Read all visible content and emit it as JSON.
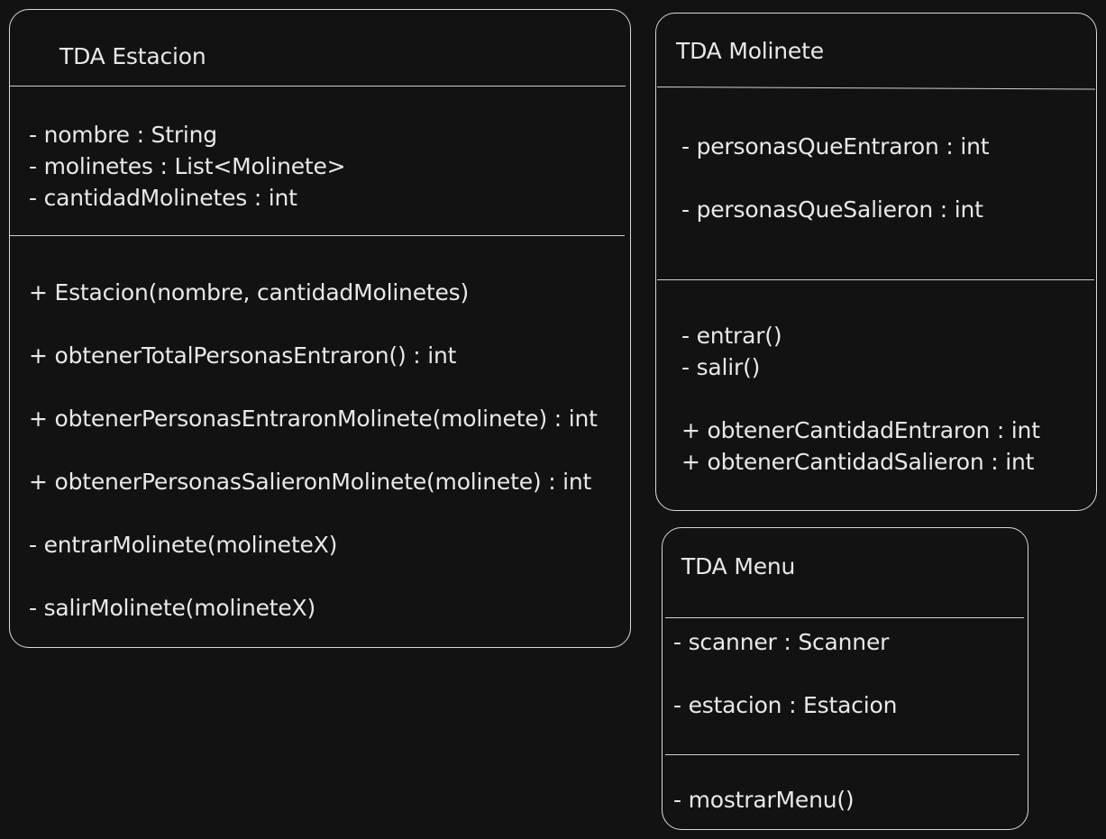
{
  "estacion": {
    "title": "TDA Estacion",
    "attributes": [
      "- nombre : String",
      "- molinetes : List<Molinete>",
      "- cantidadMolinetes : int"
    ],
    "methods": [
      "+ Estacion(nombre, cantidadMolinetes)",
      "+ obtenerTotalPersonasEntraron() : int",
      "+ obtenerPersonasEntraronMolinete(molinete) : int",
      "+ obtenerPersonasSalieronMolinete(molinete) : int",
      "- entrarMolinete(molineteX)",
      "- salirMolinete(molineteX)"
    ]
  },
  "molinete": {
    "title": "TDA Molinete",
    "attributes": [
      "- personasQueEntraron : int",
      "- personasQueSalieron : int"
    ],
    "methods": [
      "- entrar()",
      "- salir()",
      "+ obtenerCantidadEntraron : int",
      "+ obtenerCantidadSalieron : int"
    ]
  },
  "menu": {
    "title": "TDA Menu",
    "attributes": [
      "- scanner : Scanner",
      "- estacion : Estacion"
    ],
    "methods": [
      "- mostrarMenu()"
    ]
  }
}
